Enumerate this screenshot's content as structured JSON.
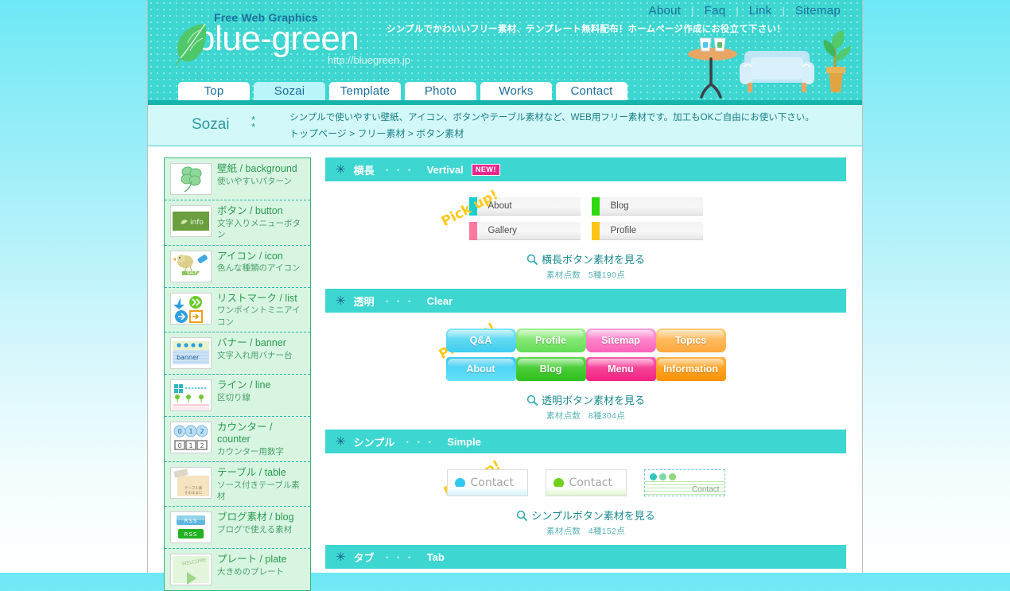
{
  "header": {
    "free_web": "Free Web Graphics",
    "brand": "blue-green",
    "url": "http://bluegreen.jp",
    "tagline": "シンプルでかわいいフリー素材、テンプレート無料配布！ホームページ作成にお役立て下さい！",
    "top_links": [
      "About",
      "Faq",
      "Link",
      "Sitemap"
    ],
    "nav": [
      {
        "label": "Top",
        "active": false
      },
      {
        "label": "Sozai",
        "active": true
      },
      {
        "label": "Template",
        "active": false
      },
      {
        "label": "Photo",
        "active": false
      },
      {
        "label": "Works",
        "active": false
      },
      {
        "label": "Contact",
        "active": false
      }
    ],
    "colors": {
      "teal": "#3dd6d0",
      "teal_dark": "#17b4ae",
      "link": "#1b6f9b"
    }
  },
  "band": {
    "title": "Sozai",
    "stars": "*\n*",
    "description": "シンプルで使いやすい壁紙、アイコン、ボタンやテーブル素材など、WEB用フリー素材です。加工もOKご自由にお使い下さい。",
    "crumbs": [
      "トップページ",
      "フリー素材",
      "ボタン素材"
    ],
    "crumb_sep": ">"
  },
  "sidebar": {
    "items": [
      {
        "title": "壁紙 / background",
        "sub": "使いやすいパターン",
        "icon": "clover-icon"
      },
      {
        "title": "ボタン / button",
        "sub": "文字入りメニューボタン",
        "icon": "menu-button-icon"
      },
      {
        "title": "アイコン / icon",
        "sub": "色んな種類のアイコン",
        "icon": "bird-icon"
      },
      {
        "title": "リストマーク / list",
        "sub": "ワンポイントミニアイコン",
        "icon": "list-mark-icon"
      },
      {
        "title": "バナー / banner",
        "sub": "文字入れ用バナー台",
        "icon": "banner-icon"
      },
      {
        "title": "ライン / line",
        "sub": "区切り線",
        "icon": "line-icon"
      },
      {
        "title": "カウンター / counter",
        "sub": "カウンター用数字",
        "icon": "counter-icon"
      },
      {
        "title": "テーブル / table",
        "sub": "ソース付きテーブル素材",
        "icon": "table-icon"
      },
      {
        "title": "ブログ素材 / blog",
        "sub": "ブログで使える素材",
        "icon": "rss-icon"
      },
      {
        "title": "プレート / plate",
        "sub": "大きめのプレート",
        "icon": "plate-icon"
      }
    ]
  },
  "sections": [
    {
      "star": "✳",
      "jp": "横長",
      "dots": "・・・",
      "en": "Vertival",
      "badge": "NEW!",
      "pickup": "Pick up!",
      "type": "horizontal",
      "buttons": [
        {
          "label": "About",
          "color": "#17d0cd"
        },
        {
          "label": "Blog",
          "color": "#30d80f"
        },
        {
          "label": "Gallery",
          "color": "#f9799f"
        },
        {
          "label": "Profile",
          "color": "#fdc516"
        }
      ],
      "more_label": "横長ボタン素材を見る",
      "count_label": "素材点数",
      "count_value": "5種190点"
    },
    {
      "star": "✳",
      "jp": "透明",
      "dots": "・・・",
      "en": "Clear",
      "badge": "",
      "pickup": "Pick up!",
      "type": "clear",
      "buttons": [
        {
          "label": "Q&A",
          "c1": "#7fe4f6",
          "c2": "#3fcdee",
          "row": 1
        },
        {
          "label": "Profile",
          "c1": "#9ef08a",
          "c2": "#63dd58",
          "row": 1
        },
        {
          "label": "Sitemap",
          "c1": "#ff9fd8",
          "c2": "#fb63bb",
          "row": 1
        },
        {
          "label": "Topics",
          "c1": "#ffcb7a",
          "c2": "#ffa83c",
          "row": 1
        },
        {
          "label": "About",
          "c1": "#3ec8f0",
          "c2": "#66e2f9",
          "row": 2
        },
        {
          "label": "Blog",
          "c1": "#5fd94f",
          "c2": "#2fbf1d",
          "row": 2
        },
        {
          "label": "Menu",
          "c1": "#fb5fae",
          "c2": "#f0217f",
          "row": 2
        },
        {
          "label": "Information",
          "c1": "#ffb347",
          "c2": "#fb9202",
          "row": 2
        }
      ],
      "more_label": "透明ボタン素材を見る",
      "count_label": "素材点数",
      "count_value": "8種304点"
    },
    {
      "star": "✳",
      "jp": "シンプル",
      "dots": "・・・",
      "en": "Simple",
      "badge": "",
      "pickup": "Pick up!",
      "type": "simple",
      "buttons": [
        {
          "label": "Contact",
          "dot": "#2fc8ee",
          "tint": "#d8f3fb"
        },
        {
          "label": "Contact",
          "dot": "#6fd11d",
          "tint": "#e2f5cf"
        },
        {
          "label": "Contact",
          "dot": "#2fc8c0",
          "tint": "#ffffff"
        }
      ],
      "more_label": "シンプルボタン素材を見る",
      "count_label": "素材点数",
      "count_value": "4種152点"
    },
    {
      "star": "✳",
      "jp": "タブ",
      "dots": "・・・",
      "en": "Tab",
      "badge": "",
      "pickup": "",
      "type": "none",
      "buttons": [],
      "more_label": "",
      "count_label": "",
      "count_value": ""
    }
  ]
}
